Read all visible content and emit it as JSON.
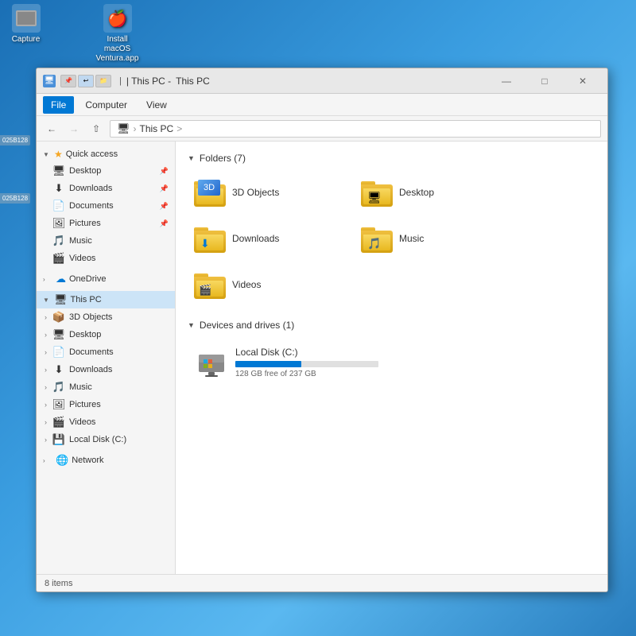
{
  "window": {
    "title": "This PC",
    "title_full": "| This PC -",
    "tab_label": "This PC"
  },
  "desktop": {
    "icon1_label": "Capture",
    "icon2_label": "Install macOS\nVentura.app"
  },
  "sidebar_labels": {
    "label1": "025B128",
    "label2": "025B128"
  },
  "menu": {
    "file": "File",
    "computer": "Computer",
    "view": "View"
  },
  "address": {
    "path_pc": "This PC",
    "path_separator": ">",
    "path_label": "This PC >"
  },
  "quick_access": {
    "header": "Quick access",
    "items": [
      {
        "label": "Desktop",
        "pinned": true,
        "icon": "desktop"
      },
      {
        "label": "Downloads",
        "pinned": true,
        "icon": "downloads"
      },
      {
        "label": "Documents",
        "pinned": true,
        "icon": "documents"
      },
      {
        "label": "Pictures",
        "pinned": true,
        "icon": "pictures"
      },
      {
        "label": "Music",
        "pinned": false,
        "icon": "music"
      },
      {
        "label": "Videos",
        "pinned": false,
        "icon": "videos"
      }
    ]
  },
  "onedrive": {
    "header": "OneDrive"
  },
  "this_pc": {
    "header": "This PC",
    "sub_items": [
      {
        "label": "3D Objects",
        "icon": "3d"
      },
      {
        "label": "Desktop",
        "icon": "desktop"
      },
      {
        "label": "Documents",
        "icon": "documents"
      },
      {
        "label": "Downloads",
        "icon": "downloads"
      },
      {
        "label": "Music",
        "icon": "music"
      },
      {
        "label": "Pictures",
        "icon": "pictures"
      },
      {
        "label": "Videos",
        "icon": "videos"
      },
      {
        "label": "Local Disk (C:)",
        "icon": "drive"
      }
    ]
  },
  "network": {
    "header": "Network"
  },
  "folders_section": {
    "title": "Folders (7)",
    "folders": [
      {
        "name": "3D Objects",
        "special": "3d"
      },
      {
        "name": "Desktop",
        "special": "desktop"
      },
      {
        "name": "Downloads",
        "special": "downloads"
      },
      {
        "name": "Music",
        "special": "music"
      },
      {
        "name": "Videos",
        "special": "videos"
      }
    ]
  },
  "drives_section": {
    "title": "Devices and drives (1)",
    "drives": [
      {
        "name": "Local Disk (C:)",
        "free": "128 GB free of 237 GB",
        "fill_percent": 46,
        "icon": "drive"
      }
    ]
  },
  "status_bar": {
    "count": "8 items"
  },
  "colors": {
    "accent": "#0078d4",
    "folder_yellow": "#f0c040",
    "selected_bg": "#cce4f7"
  }
}
